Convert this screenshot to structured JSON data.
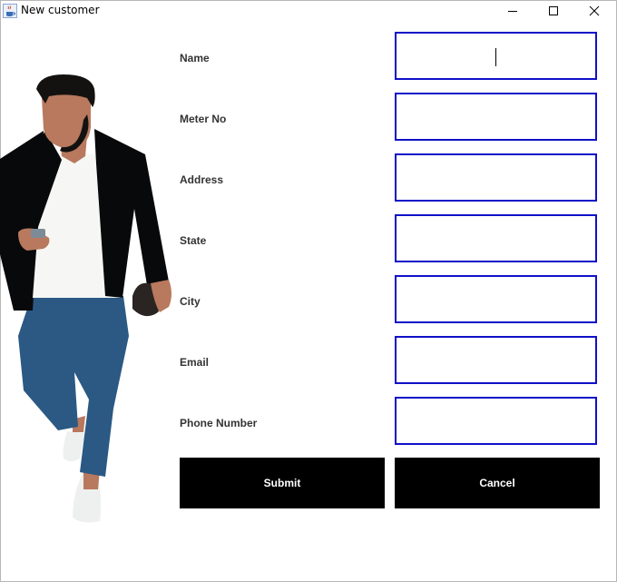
{
  "window": {
    "title": "New customer",
    "icons": [
      "java-cup-icon",
      "minimize-icon",
      "maximize-icon",
      "close-icon"
    ]
  },
  "form": {
    "fields": [
      {
        "label": "Name",
        "value": ""
      },
      {
        "label": "Meter No",
        "value": ""
      },
      {
        "label": "Address",
        "value": ""
      },
      {
        "label": "State",
        "value": ""
      },
      {
        "label": "City",
        "value": ""
      },
      {
        "label": "Email",
        "value": ""
      },
      {
        "label": "Phone Number",
        "value": ""
      }
    ],
    "submit_label": "Submit",
    "cancel_label": "Cancel"
  },
  "colors": {
    "field_border": "#1010c8",
    "button_bg": "#000000",
    "button_text": "#ffffff",
    "label_text": "#333333"
  }
}
